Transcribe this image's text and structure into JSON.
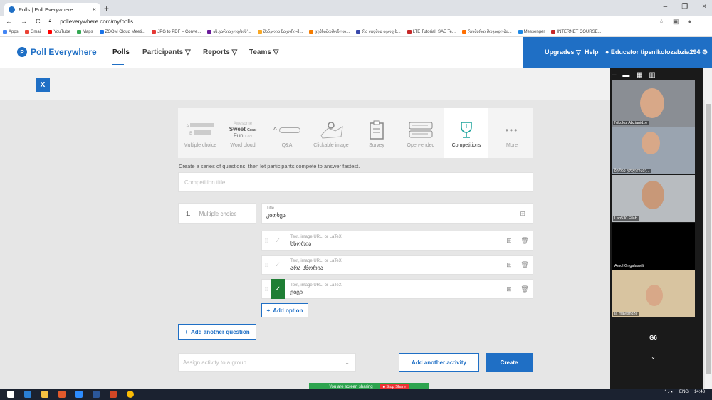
{
  "browser": {
    "tab_title": "Polls | Poll Everywhere",
    "tab_close": "×",
    "new_tab": "+",
    "url": "polleverywhere.com/my/polls",
    "bookmarks": [
      "Apps",
      "Gmail",
      "YouTube",
      "Maps",
      "ZOOM Cloud Meeti...",
      "JPG to PDF – Conve...",
      "აზ.ვარიაცოფსის'...",
      "მაწვოის ნაცოჩი-მ...",
      "ვუპჩამომოჩოდ...",
      "რა ოდმია იცოფს...",
      "LTE Tutorial: SAE Te...",
      "რომართ მოვიდობი...",
      "Messenger",
      "INTERNET COURSE..."
    ],
    "window_controls": [
      "–",
      "❐",
      "×"
    ]
  },
  "header": {
    "logo": "Poll Everywhere",
    "nav": [
      "Polls",
      "Participants ▽",
      "Reports ▽",
      "Teams ▽"
    ],
    "right": {
      "upgrades": "Upgrades ▽",
      "help": "Help",
      "tips": "● Educator tips",
      "user": "nikolozabzia294 ⚙"
    }
  },
  "close_label": "X",
  "activity_types": [
    {
      "label": "Multiple choice"
    },
    {
      "label": "Word cloud",
      "words": [
        "Awesome",
        "Sweet",
        "Great",
        "Fun",
        "Cool"
      ]
    },
    {
      "label": "Q&A"
    },
    {
      "label": "Clickable image"
    },
    {
      "label": "Survey"
    },
    {
      "label": "Open-ended"
    },
    {
      "label": "Competitions"
    },
    {
      "label": "More"
    }
  ],
  "choice_letters": [
    "A",
    "B"
  ],
  "description": "Create a series of questions, then let participants compete to answer fastest.",
  "competition_title_placeholder": "Competition title",
  "question": {
    "number": "1.",
    "type": "Multiple choice",
    "title_label": "Title",
    "title_value": "კითხვა",
    "option_label": "Text, image URL, or LaTeX",
    "options": [
      {
        "value": "სწორია",
        "correct": false
      },
      {
        "value": "არა სწორია",
        "correct": false
      },
      {
        "value": "ვიცი",
        "correct": true
      }
    ]
  },
  "buttons": {
    "add_option": "Add option",
    "add_question": "Add another question",
    "group_placeholder": "Assign activity to a group",
    "add_activity": "Add another activity",
    "create": "Create"
  },
  "share": {
    "text": "You are screen sharing",
    "stop": "■ Stop Share"
  },
  "video": {
    "participants": [
      "Nikoloz Abzianidze",
      "ზურაბ გოგელაძე...",
      "Lab530 Filab",
      "Amol Gngalasvili",
      "ia mavitmdze"
    ],
    "group_name": "G6",
    "chevron": "⌄"
  },
  "tray": {
    "time": "14:48",
    "lang": "ENG"
  }
}
